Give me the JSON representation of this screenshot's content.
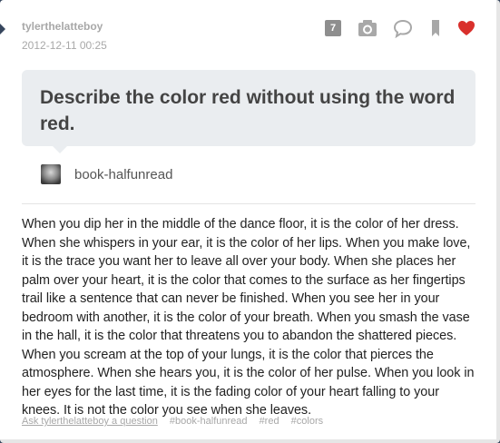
{
  "post": {
    "username": "tylerthelatteboy",
    "timestamp": "2012-12-11 00:25",
    "notes_count": "7"
  },
  "icons": [
    "photo-icon",
    "comment-icon",
    "bookmark-icon",
    "heart-icon"
  ],
  "colors": {
    "heart": "#d9302c",
    "icon": "#a8a8a8",
    "badge": "#8e8e8e"
  },
  "question": {
    "text": "Describe the color red without using the word red.",
    "asker": "book-halfunread"
  },
  "answer": {
    "text": "When you dip her in the middle of the dance floor, it is the color of her dress. When she whispers in your ear, it is the color of her lips. When you make love, it is the trace you want her to leave all over your body. When she places her palm over your heart, it is the color that comes to the surface as her fingertips trail like a sentence that can never be finished. When you see her in your bedroom with another, it is the color of your breath. When you smash the vase in the hall, it is the color that threatens you to abandon the shattered pieces. When you scream at the top of your lungs, it is the color that pierces the atmosphere. When she hears you, it is the color of her pulse. When you look in her eyes for the last time, it is the fading color of your heart falling to your knees. It is not the color you see when she leaves."
  },
  "footer": {
    "ask_link": "Ask tylerthelatteboy a question",
    "tags": [
      "#book-halfunread",
      "#red",
      "#colors"
    ]
  }
}
